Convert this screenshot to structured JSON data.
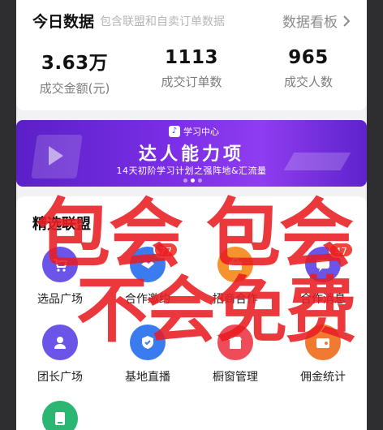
{
  "today": {
    "title": "今日数据",
    "subtitle": "包含联盟和自卖订单数据",
    "dashboard_link": "数据看板",
    "stats": [
      {
        "value": "3.63万",
        "label": "成交金额(元)"
      },
      {
        "value": "1113",
        "label": "成交订单数"
      },
      {
        "value": "965",
        "label": "成交人数"
      }
    ]
  },
  "banner": {
    "brand": "学习中心",
    "title": "达人能力项",
    "subtitle": "14天初阶学习计划之强阵地&汇流量",
    "active_dot": 1
  },
  "selected": {
    "title": "精选联盟",
    "tiles": [
      {
        "label": "选品广场",
        "icon": "cart-icon",
        "color": "#6a55e8"
      },
      {
        "label": "合作邀约",
        "icon": "handshake-icon",
        "color": "#3a7bf0",
        "badge": "77"
      },
      {
        "label": "招商合作",
        "icon": "briefcase-icon",
        "color": "#f5932e"
      },
      {
        "label": "合作消息",
        "icon": "message-icon",
        "color": "#6a55e8",
        "badge": "47"
      },
      {
        "label": "团长广场",
        "icon": "user-icon",
        "color": "#6a55e8"
      },
      {
        "label": "基地直播",
        "icon": "shield-icon",
        "color": "#3a7bf0"
      },
      {
        "label": "橱窗管理",
        "icon": "shop-icon",
        "color": "#ef4c5a"
      },
      {
        "label": "佣金统计",
        "icon": "wallet-icon",
        "color": "#f07a30"
      },
      {
        "label": "",
        "icon": "device-icon",
        "color": "#2bb673"
      }
    ]
  },
  "overlay": {
    "line1": "包会 包会",
    "line2": "不会免费"
  }
}
